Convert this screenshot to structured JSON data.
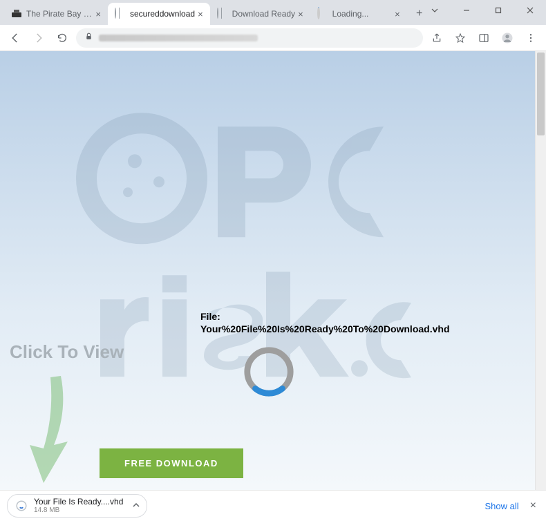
{
  "tabs": [
    {
      "label": "The Pirate Bay - The g",
      "favicon": "pirate"
    },
    {
      "label": "secureddownload",
      "favicon": "globe",
      "active": true
    },
    {
      "label": "Download Ready",
      "favicon": "globe"
    },
    {
      "label": "Loading...",
      "favicon": "spinner"
    }
  ],
  "page": {
    "file_label": "File:",
    "file_name": "Your%20File%20Is%20Ready%20To%20Download.vhd",
    "click_to_view": "Click To View",
    "download_button": "FREE DOWNLOAD"
  },
  "download_bar": {
    "file_name": "Your File Is Ready....vhd",
    "file_size": "14.8 MB",
    "show_all": "Show all"
  }
}
